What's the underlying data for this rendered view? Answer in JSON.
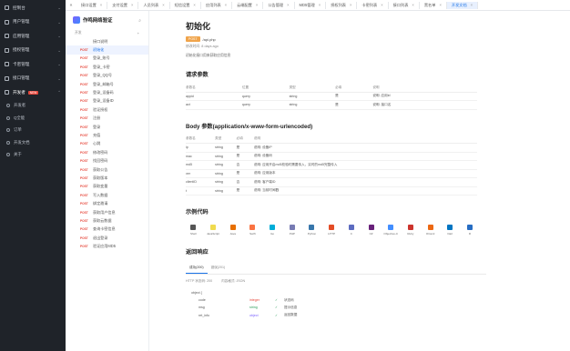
{
  "sidebar": {
    "items": [
      {
        "label": "控制台",
        "icon": "dashboard-icon"
      },
      {
        "label": "用户管理",
        "icon": "user-icon"
      },
      {
        "label": "应用管理",
        "icon": "app-icon"
      },
      {
        "label": "授权管理",
        "icon": "key-icon"
      },
      {
        "label": "卡密管理",
        "icon": "card-icon"
      },
      {
        "label": "接口管理",
        "icon": "api-icon"
      },
      {
        "label": "开发者",
        "icon": "code-icon",
        "badge": "NEW"
      }
    ],
    "subitems": [
      "开发者",
      "Q全能",
      "订单"
    ],
    "bottom": [
      "开发文档",
      "关于"
    ]
  },
  "tabs": [
    "接口设置",
    "支付设置",
    "人员列表",
    "短信设置",
    "应用列表",
    "云端配置",
    "公告管理",
    "MD5管理",
    "授权列表",
    "卡密列表",
    "接口列表",
    "黑名单",
    "开发文档"
  ],
  "doc": {
    "title": "作鸣网络验证",
    "section": "开发",
    "links": [
      {
        "m": "",
        "l": "接口说明"
      },
      {
        "m": "POST",
        "l": "初始化",
        "active": true
      },
      {
        "m": "POST",
        "l": "登录_账号"
      },
      {
        "m": "POST",
        "l": "登录_卡密"
      },
      {
        "m": "POST",
        "l": "登录_QQ号"
      },
      {
        "m": "POST",
        "l": "登录_邮箱号"
      },
      {
        "m": "POST",
        "l": "登录_设备码"
      },
      {
        "m": "POST",
        "l": "登录_设备ID"
      },
      {
        "m": "POST",
        "l": "验证授权"
      },
      {
        "m": "POST",
        "l": "注册"
      },
      {
        "m": "POST",
        "l": "登录"
      },
      {
        "m": "POST",
        "l": "充值"
      },
      {
        "m": "POST",
        "l": "心跳"
      },
      {
        "m": "POST",
        "l": "修改密码"
      },
      {
        "m": "POST",
        "l": "找回密码"
      },
      {
        "m": "POST",
        "l": "获取公告"
      },
      {
        "m": "POST",
        "l": "获取版本"
      },
      {
        "m": "POST",
        "l": "获取变量"
      },
      {
        "m": "POST",
        "l": "写入数据"
      },
      {
        "m": "POST",
        "l": "绑定邀请"
      },
      {
        "m": "POST",
        "l": "获取用户信息"
      },
      {
        "m": "POST",
        "l": "获取云数据"
      },
      {
        "m": "POST",
        "l": "查询卡密信息"
      },
      {
        "m": "POST",
        "l": "退出登录"
      },
      {
        "m": "POST",
        "l": "验证应用MD5"
      }
    ]
  },
  "main": {
    "title": "初始化",
    "method": "POST",
    "path": "/api.php",
    "meta": "修改时间: 8 days ago",
    "desc": "初始化接口用来获取应用信息",
    "req_title": "请求参数",
    "req_headers": [
      "参数名",
      "位置",
      "类型",
      "必填",
      "说明"
    ],
    "req_rows": [
      [
        "appid",
        "query",
        "string",
        "是",
        "说明: 应用id"
      ],
      [
        "act",
        "query",
        "string",
        "是",
        "说明: 接口名"
      ]
    ],
    "body_title": "Body 参数(application/x-www-form-urlencoded)",
    "body_headers": [
      "参数名",
      "类型",
      "必填",
      "说明"
    ],
    "body_rows": [
      [
        "ip",
        "string",
        "是",
        "说明: 设备IP"
      ],
      [
        "mac",
        "string",
        "是",
        "说明: 设备码"
      ],
      [
        "md5",
        "string",
        "否",
        "说明: 应用开启md5校验时需要传入，实时的md5完整传入"
      ],
      [
        "ver",
        "string",
        "是",
        "说明: 应用版本"
      ],
      [
        "clientID",
        "string",
        "否",
        "说明: 客户端ID"
      ],
      [
        "t",
        "string",
        "是",
        "说明: 当前时间戳"
      ]
    ],
    "code_title": "示例代码",
    "langs": [
      "Shell",
      "JavaScript",
      "Java",
      "Swift",
      "Go",
      "PHP",
      "Python",
      "HTTP",
      "C",
      "C#",
      "Objective-C",
      "Ruby",
      "OCaml",
      "Dart",
      "R"
    ],
    "resp_title": "返回响应",
    "resp_tabs": [
      "成功(200)",
      "错误(201)"
    ],
    "resp_meta": [
      "HTTP 状态码: 200",
      "内容格式: JSON"
    ],
    "tree": [
      [
        "object {",
        "",
        "",
        ""
      ],
      [
        "code",
        "integer",
        "✓",
        "状态码"
      ],
      [
        "msg",
        "string",
        "✓",
        "提示信息"
      ],
      [
        "ret_info",
        "object",
        "✓",
        "返回数据"
      ]
    ]
  }
}
